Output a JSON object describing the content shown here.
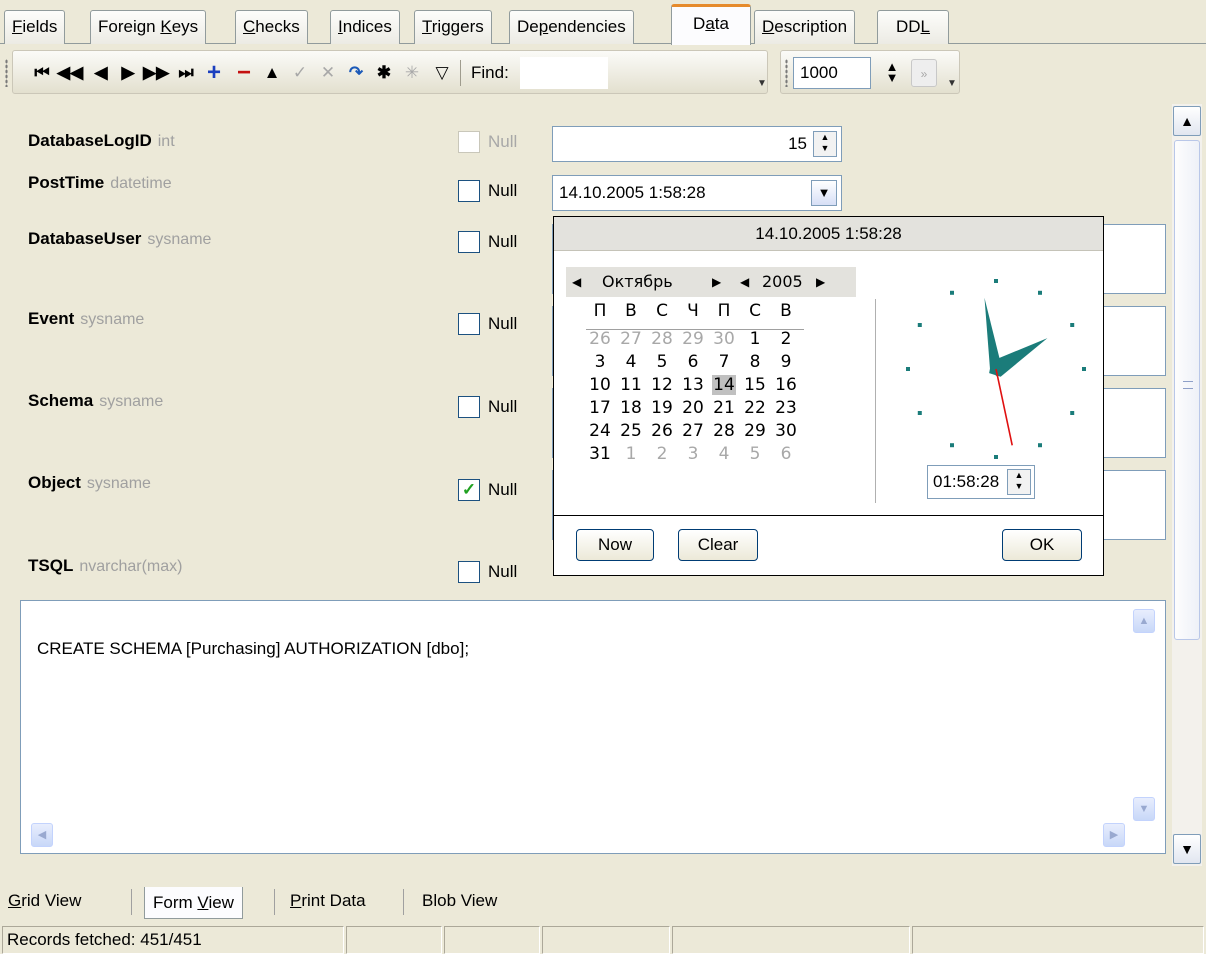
{
  "tabs": [
    {
      "label": "Fields",
      "mnemonic": "F",
      "rest": "ields",
      "pre": ""
    },
    {
      "label": "Foreign Keys",
      "pre": "Foreign ",
      "mnemonic": "K",
      "rest": "eys"
    },
    {
      "label": "Checks",
      "pre": "",
      "mnemonic": "C",
      "rest": "hecks"
    },
    {
      "label": "Indices",
      "pre": "",
      "mnemonic": "I",
      "rest": "ndices"
    },
    {
      "label": "Triggers",
      "pre": "",
      "mnemonic": "T",
      "rest": "riggers"
    },
    {
      "label": "Dependencies",
      "pre": "De",
      "mnemonic": "p",
      "rest": "endencies"
    },
    {
      "label": "Data",
      "pre": "D",
      "mnemonic": "a",
      "rest": "ta"
    },
    {
      "label": "Description",
      "pre": "",
      "mnemonic": "D",
      "rest": "escription"
    },
    {
      "label": "DDL",
      "pre": "DD",
      "mnemonic": "L",
      "rest": ""
    }
  ],
  "active_tab": "Data",
  "toolbar": {
    "find_label": "Find:",
    "find_value": "",
    "record_limit": "1000",
    "icons": [
      "first-record-icon",
      "prev-page-icon",
      "prev-record-icon",
      "next-record-icon",
      "next-page-icon",
      "last-record-icon",
      "insert-record-icon",
      "delete-record-icon",
      "edit-record-icon",
      "post-edit-icon",
      "cancel-edit-icon",
      "refresh-icon",
      "asterisk-icon",
      "clear-asterisk-icon",
      "filter-icon"
    ]
  },
  "fields": [
    {
      "name": "DatabaseLogID",
      "type": "int",
      "null_label": "Null",
      "null_checked": false,
      "null_disabled": true,
      "value": "15"
    },
    {
      "name": "PostTime",
      "type": "datetime",
      "null_label": "Null",
      "null_checked": false,
      "null_disabled": false,
      "value": "14.10.2005 1:58:28"
    },
    {
      "name": "DatabaseUser",
      "type": "sysname",
      "null_label": "Null",
      "null_checked": false,
      "null_disabled": false,
      "value": ""
    },
    {
      "name": "Event",
      "type": "sysname",
      "null_label": "Null",
      "null_checked": false,
      "null_disabled": false,
      "value": ""
    },
    {
      "name": "Schema",
      "type": "sysname",
      "null_label": "Null",
      "null_checked": false,
      "null_disabled": false,
      "value": ""
    },
    {
      "name": "Object",
      "type": "sysname",
      "null_label": "Null",
      "null_checked": true,
      "null_disabled": false,
      "value": ""
    },
    {
      "name": "TSQL",
      "type": "nvarchar(max)",
      "null_label": "Null",
      "null_checked": false,
      "null_disabled": false,
      "value": "CREATE SCHEMA [Purchasing] AUTHORIZATION [dbo];"
    }
  ],
  "datetime_popup": {
    "header": "14.10.2005 1:58:28",
    "month": "Октябрь",
    "year": "2005",
    "weekdays": [
      "П",
      "В",
      "С",
      "Ч",
      "П",
      "С",
      "В"
    ],
    "weeks": [
      [
        {
          "d": "26",
          "o": true
        },
        {
          "d": "27",
          "o": true
        },
        {
          "d": "28",
          "o": true
        },
        {
          "d": "29",
          "o": true
        },
        {
          "d": "30",
          "o": true
        },
        {
          "d": "1"
        },
        {
          "d": "2"
        }
      ],
      [
        {
          "d": "3"
        },
        {
          "d": "4"
        },
        {
          "d": "5"
        },
        {
          "d": "6"
        },
        {
          "d": "7"
        },
        {
          "d": "8"
        },
        {
          "d": "9"
        }
      ],
      [
        {
          "d": "10"
        },
        {
          "d": "11"
        },
        {
          "d": "12"
        },
        {
          "d": "13"
        },
        {
          "d": "14",
          "sel": true
        },
        {
          "d": "15"
        },
        {
          "d": "16"
        }
      ],
      [
        {
          "d": "17"
        },
        {
          "d": "18"
        },
        {
          "d": "19"
        },
        {
          "d": "20"
        },
        {
          "d": "21"
        },
        {
          "d": "22"
        },
        {
          "d": "23"
        }
      ],
      [
        {
          "d": "24"
        },
        {
          "d": "25"
        },
        {
          "d": "26"
        },
        {
          "d": "27"
        },
        {
          "d": "28"
        },
        {
          "d": "29"
        },
        {
          "d": "30"
        }
      ],
      [
        {
          "d": "31"
        },
        {
          "d": "1",
          "o": true
        },
        {
          "d": "2",
          "o": true
        },
        {
          "d": "3",
          "o": true
        },
        {
          "d": "4",
          "o": true
        },
        {
          "d": "5",
          "o": true
        },
        {
          "d": "6",
          "o": true
        }
      ]
    ],
    "time": "01:58:28",
    "clock_hands": {
      "hour": 1,
      "minute": 58,
      "second": 28
    },
    "colors": {
      "hands": "#1b7c7a",
      "second_hand": "#e01010"
    },
    "buttons": {
      "now": "Now",
      "clear": "Clear",
      "ok": "OK"
    }
  },
  "view_tabs": [
    {
      "label": "Grid View",
      "pre": "",
      "mnemonic": "G",
      "rest": "rid View"
    },
    {
      "label": "Form View",
      "pre": "Form ",
      "mnemonic": "V",
      "rest": "iew"
    },
    {
      "label": "Print Data",
      "pre": "",
      "mnemonic": "P",
      "rest": "rint Data"
    },
    {
      "label": "Blob View",
      "pre": "",
      "mnemonic": "",
      "rest": "Blob View"
    }
  ],
  "active_view": "Form View",
  "status": {
    "records": "Records fetched: 451/451"
  }
}
